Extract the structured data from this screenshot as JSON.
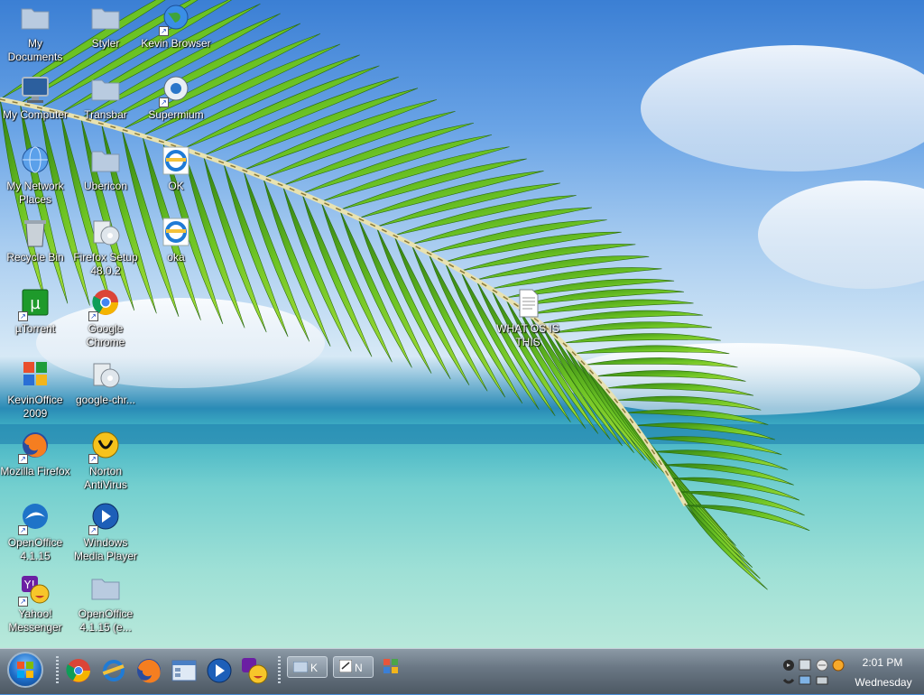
{
  "desktop": {
    "icons": [
      {
        "label": "My Documents"
      },
      {
        "label": "Styler"
      },
      {
        "label": "Kevin Browser"
      },
      {
        "label": "My Computer"
      },
      {
        "label": "Transbar"
      },
      {
        "label": "Supermium"
      },
      {
        "label": "My Network Places"
      },
      {
        "label": "Ubericon"
      },
      {
        "label": "OK"
      },
      {
        "label": "Recycle Bin"
      },
      {
        "label": "Firefox Setup 48.0.2"
      },
      {
        "label": "oka"
      },
      {
        "label": "µTorrent"
      },
      {
        "label": "Google Chrome"
      },
      {
        "label": "KevinOffice 2009"
      },
      {
        "label": "google-chr..."
      },
      {
        "label": "Mozilla Firefox"
      },
      {
        "label": "Norton AntiVirus"
      },
      {
        "label": "OpenOffice 4.1.15"
      },
      {
        "label": "Windows Media Player"
      },
      {
        "label": "Yahoo! Messenger"
      },
      {
        "label": "OpenOffice 4.1.15 (e..."
      },
      {
        "label": "WHAT OS IS THIS"
      }
    ]
  },
  "taskbar": {
    "quick_launch": [
      "chrome-icon",
      "internet-explorer-icon",
      "firefox-icon",
      "explorer-icon",
      "media-player-icon",
      "yahoo-messenger-icon"
    ],
    "tasks": [
      {
        "label": "K"
      },
      {
        "label": "N"
      }
    ],
    "clock": {
      "time": "2:01 PM",
      "day": "Wednesday"
    }
  },
  "colors": {
    "taskbar": "#6b7885",
    "label_text": "#ffffff",
    "palm_green": "#5fb821"
  }
}
